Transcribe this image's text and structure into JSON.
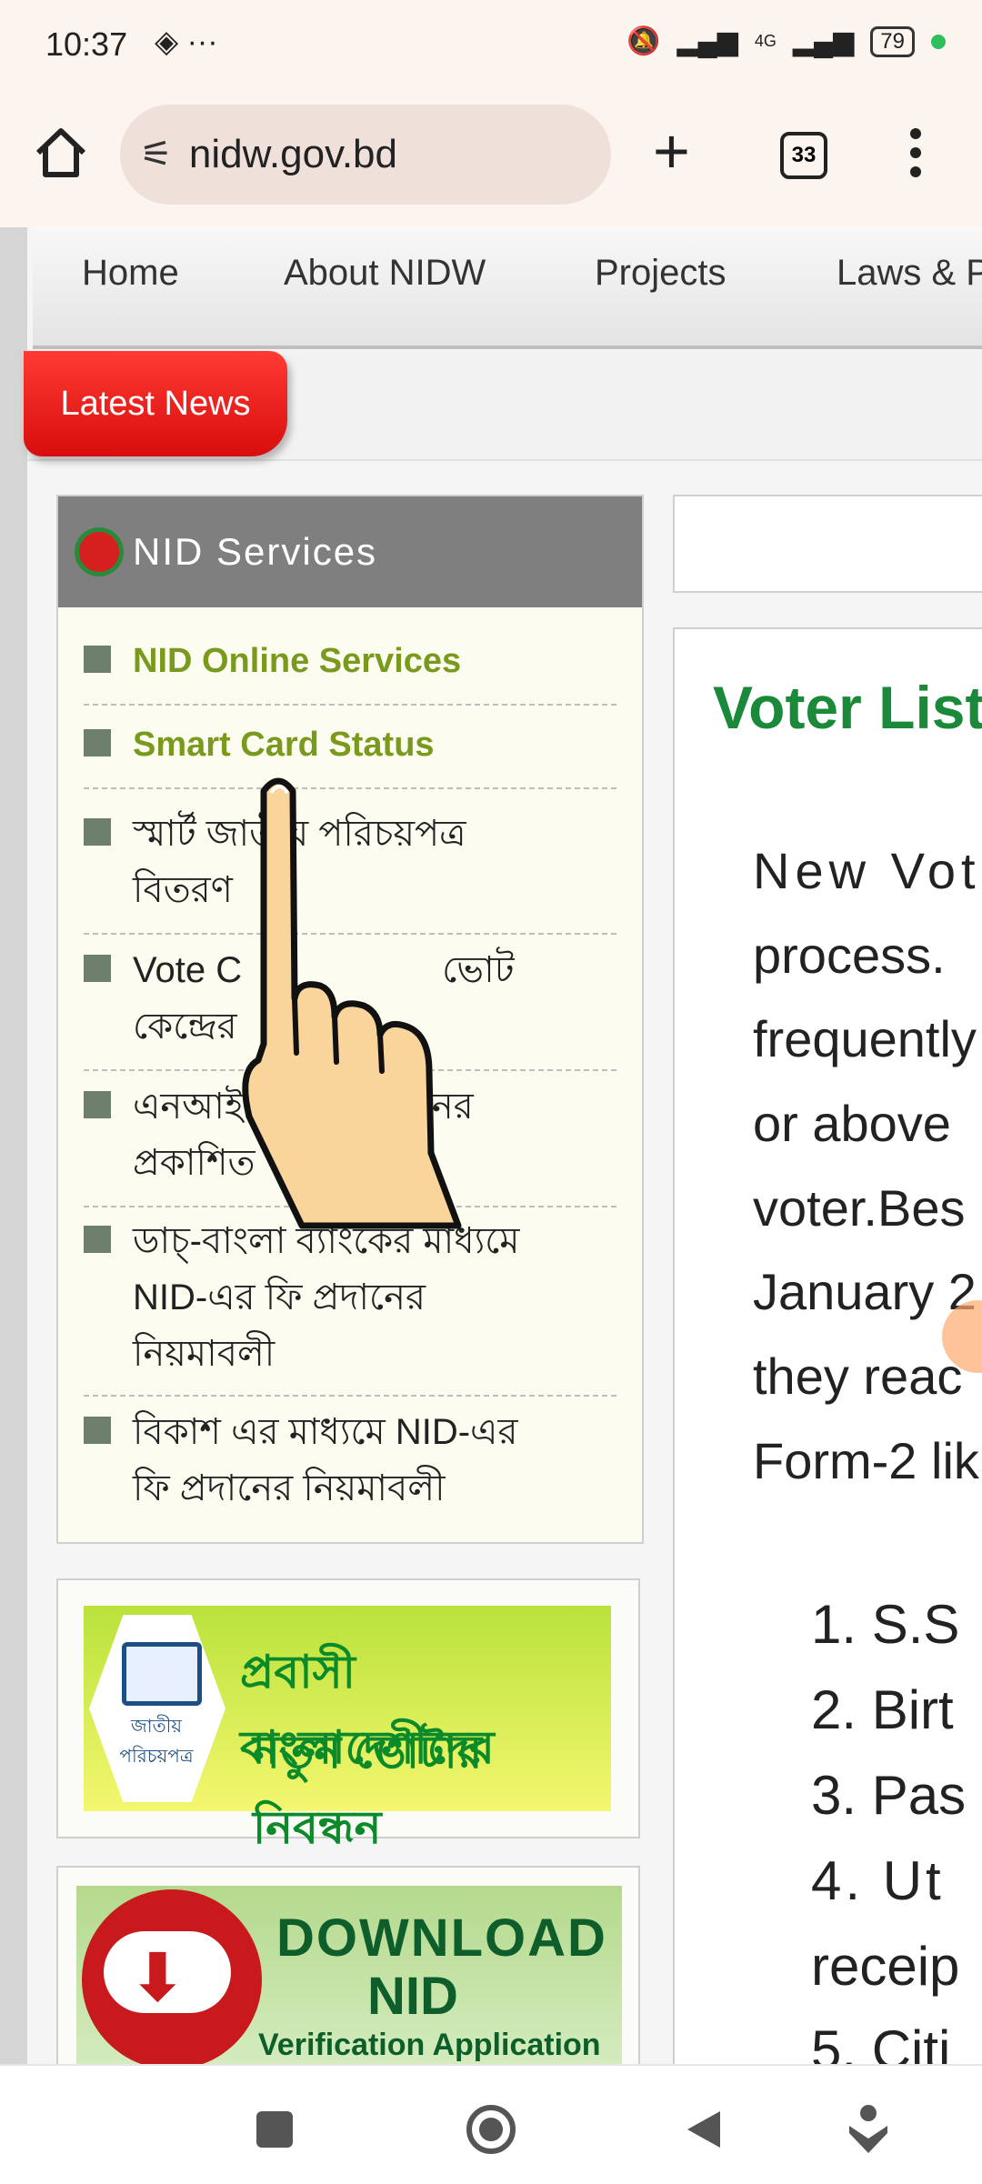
{
  "status_bar": {
    "time": "10:37",
    "left_icons": "◈ ···",
    "network": "4G",
    "battery": "79"
  },
  "browser": {
    "url": "nidw.gov.bd",
    "tab_count": "33"
  },
  "nav": {
    "items": [
      "Home",
      "About NIDW",
      "Projects",
      "Laws & P"
    ]
  },
  "latest_news_label": "Latest News",
  "nid_services": {
    "title": "NID Services",
    "items": [
      {
        "line1": "NID Online Services",
        "line2": "",
        "line3": ""
      },
      {
        "line1": "Smart Card Status",
        "line2": "",
        "line3": ""
      },
      {
        "line1": "স্মার্ট জাতীয় পরিচয়পত্র",
        "line2": "বিতরণ",
        "line3": ""
      },
      {
        "line1": "Vote C",
        "line2": "কেন্দ্রের",
        "line3": ""
      },
      {
        "line1": "এনআইডি",
        "line2": "প্রকাশিত",
        "line3": ""
      },
      {
        "line1": "ডাচ্-বাংলা ব্যাংকের মাধ্যমে",
        "line2": "NID-এর ফি প্রদানের",
        "line3": "নিয়মাবলী"
      },
      {
        "line1": "বিকাশ এর মাধ্যমে NID-এর",
        "line2": "ফি প্রদানের নিয়মাবলী",
        "line3": ""
      }
    ],
    "item4_right": "ভোট",
    "item5_right": "নের"
  },
  "banner1": {
    "line1": "প্রবাসী বাংলাদেশীদের",
    "line2": "নতুন ভোটার নিবন্ধন",
    "card_text": "জাতীয় পরিচয়পত্র"
  },
  "banner2": {
    "line1": "DOWNLOAD",
    "line2": "NID",
    "line3": "Verification Application"
  },
  "main": {
    "title": "Voter List",
    "paragraph": [
      "New  Vot",
      "process.",
      "frequently",
      "or above",
      "voter.Bes",
      "January 2",
      "they reac",
      "Form-2 lik"
    ],
    "list": [
      "1. S.S",
      "2. Birt",
      "3. Pas",
      "4.  Ut",
      "receip",
      "5. Citi"
    ]
  }
}
